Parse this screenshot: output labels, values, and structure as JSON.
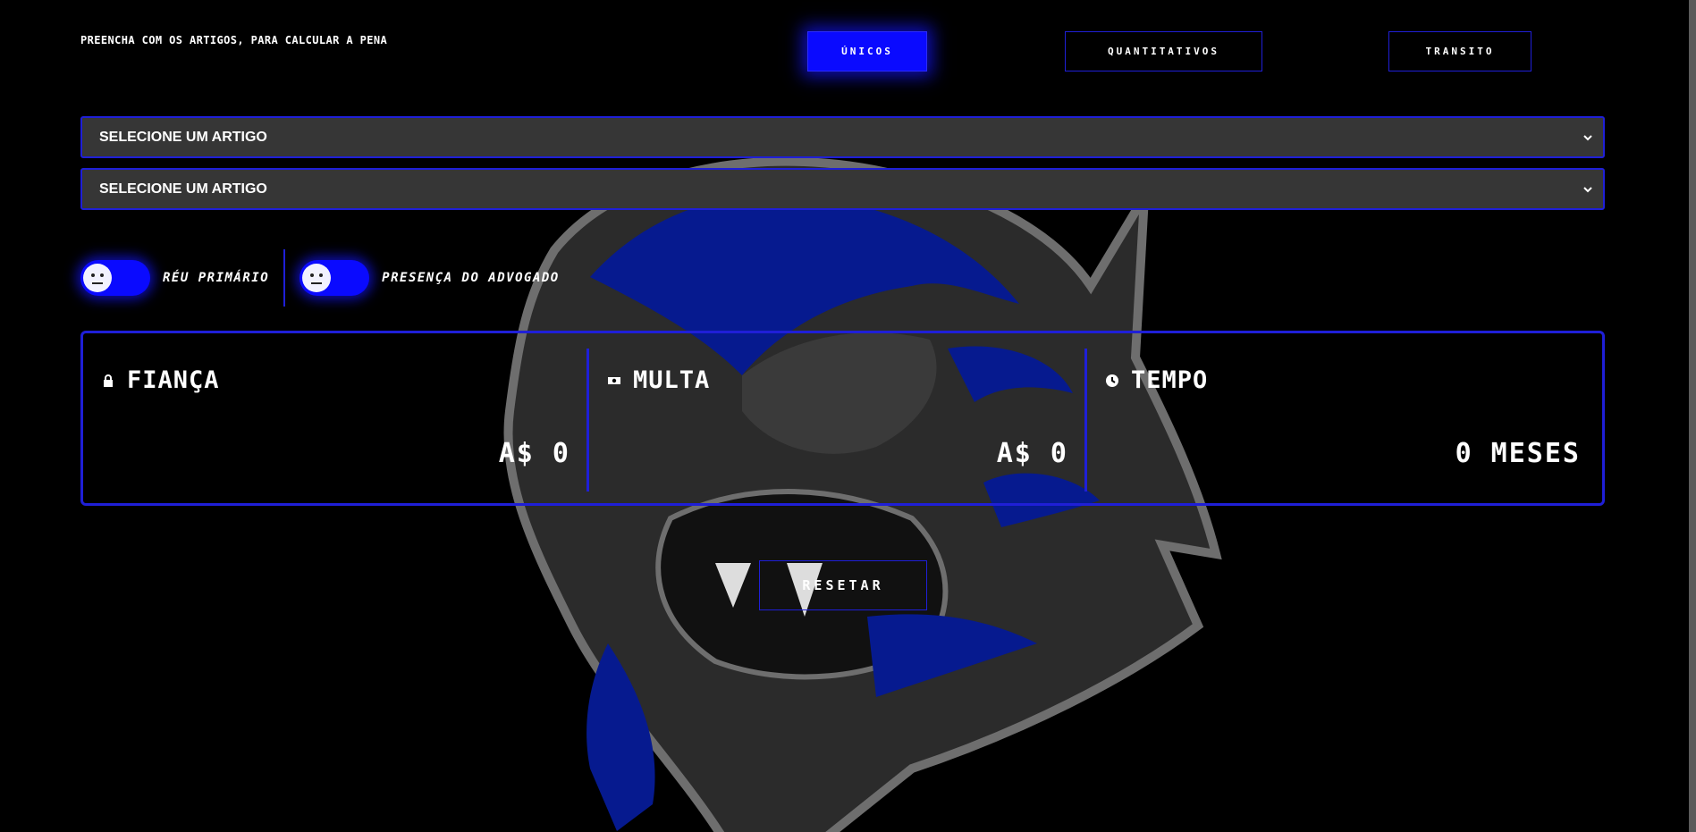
{
  "header": {
    "instruction": "PREENCHA COM OS ARTIGOS, PARA CALCULAR A PENA"
  },
  "tabs": [
    {
      "label": "ÚNICOS",
      "active": true
    },
    {
      "label": "QUANTITATIVOS",
      "active": false
    },
    {
      "label": "TRANSITO",
      "active": false
    }
  ],
  "selects": [
    {
      "value": "SELECIONE UM ARTIGO"
    },
    {
      "value": "SELECIONE UM ARTIGO"
    }
  ],
  "toggles": [
    {
      "label": "RÉU PRIMÁRIO",
      "checked": false
    },
    {
      "label": "PRESENÇA DO ADVOGADO",
      "checked": false
    }
  ],
  "results": {
    "fianca": {
      "title": "FIANÇA",
      "value": "A$ 0",
      "icon": "lock-icon"
    },
    "multa": {
      "title": "MULTA",
      "value": "A$ 0",
      "icon": "money-icon"
    },
    "tempo": {
      "title": "TEMPO",
      "value": "0 MESES",
      "icon": "clock-icon"
    }
  },
  "reset_label": "RESETAR",
  "colors": {
    "accent": "#0a0aff",
    "border": "#1f1fd7",
    "background": "#000000",
    "select_bg": "#363636"
  }
}
